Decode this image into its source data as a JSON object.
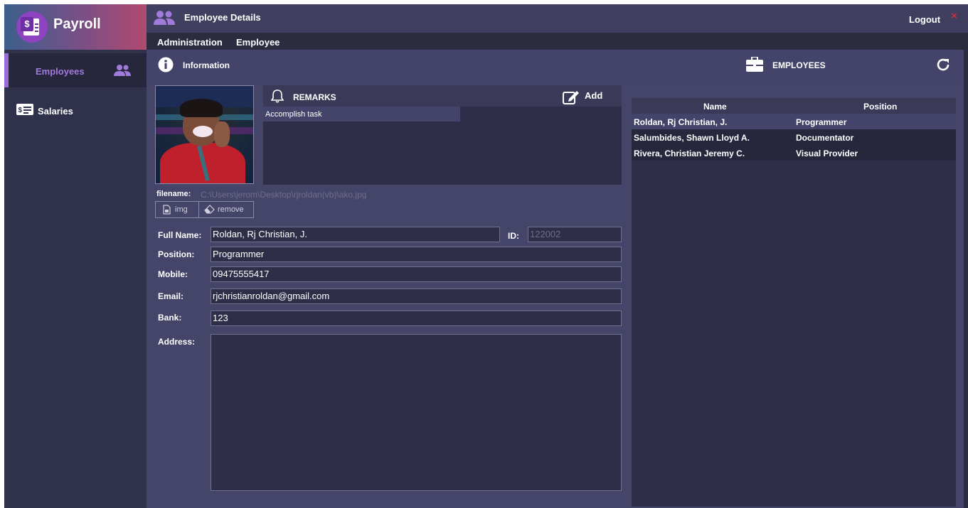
{
  "app": {
    "title": "Payroll",
    "window_title": "Employee Details",
    "logout": "Logout",
    "close": "×"
  },
  "sidebar": {
    "items": [
      {
        "label": "Employees",
        "icon": "users-icon",
        "active": true
      },
      {
        "label": "Salaries",
        "icon": "money-icon",
        "active": false
      }
    ]
  },
  "menu": {
    "items": [
      "Administration",
      "Employee"
    ]
  },
  "toolbar": {
    "info_label": "Information",
    "employees_label": "EMPLOYEES"
  },
  "remarks": {
    "title": "REMARKS",
    "add_label": "Add",
    "items": [
      "Accomplish task"
    ]
  },
  "photo": {
    "filename_label": "filename:",
    "filename": "C:\\Users\\jerom\\Desktop\\rjroldan(vb)\\ako.jpg",
    "img_button": "img",
    "remove_button": "remove"
  },
  "form": {
    "full_name_label": "Full Name:",
    "full_name": "Roldan, Rj Christian, J.",
    "id_label": "ID:",
    "id": "122002",
    "position_label": "Position:",
    "position": "Programmer",
    "mobile_label": "Mobile:",
    "mobile": "09475555417",
    "email_label": "Email:",
    "email": "rjchristianroldan@gmail.com",
    "bank_label": "Bank:",
    "bank": "123",
    "address_label": "Address:",
    "address": ""
  },
  "employees_table": {
    "columns": [
      "Name",
      "Position"
    ],
    "rows": [
      {
        "name": "Roldan, Rj Christian, J.",
        "position": "Programmer",
        "selected": true
      },
      {
        "name": "Salumbides, Shawn Lloyd A.",
        "position": "Documentator",
        "selected": false
      },
      {
        "name": "Rivera, Christian Jeremy C.",
        "position": "Visual Provider",
        "selected": false
      }
    ]
  },
  "colors": {
    "accent": "#9a6bd6",
    "close": "#c0343c",
    "background": "#2b2c40",
    "panel": "#45456a"
  }
}
